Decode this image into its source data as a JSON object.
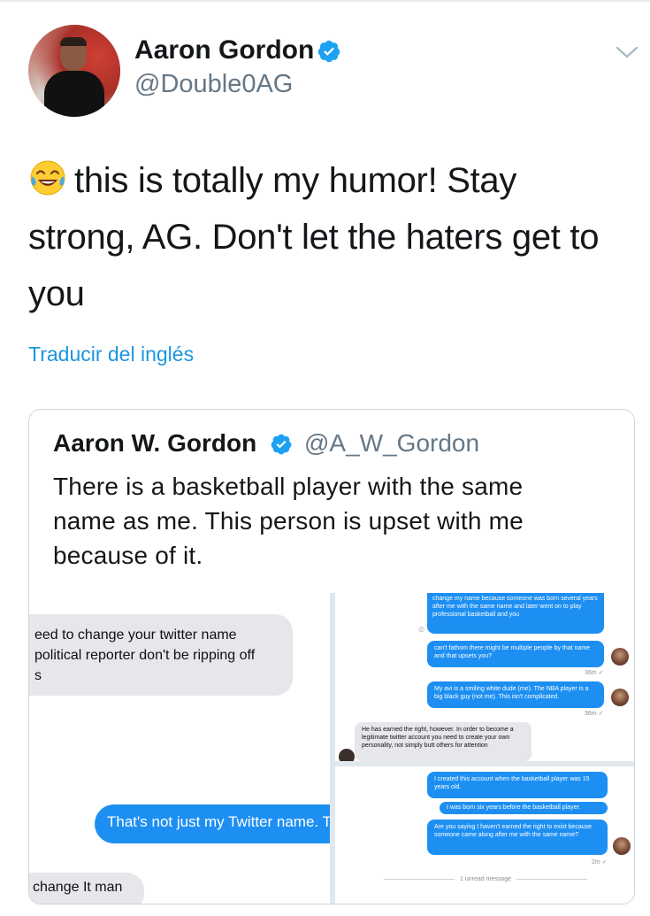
{
  "tweet": {
    "author_name": "Aaron Gordon",
    "author_handle": "@Double0AG",
    "emoji": "face-with-tears-of-joy",
    "line1": "this is totally my humor! Stay",
    "line2": "strong, AG. Don't let the haters get to",
    "line3": "you",
    "translate_link": "Traducir del inglés"
  },
  "quoted": {
    "author_name": "Aaron W. Gordon",
    "author_handle": "@A_W_Gordon",
    "line1": "There is a basketball player with the same",
    "line2": "name as me. This person is upset with me",
    "line3": "because of it."
  },
  "media": {
    "left": {
      "gray1_l1": "eed to change your twitter name",
      "gray1_l2": " political reporter don't be ripping off",
      "gray1_l3": "s",
      "blue1": "That's not just my Twitter name. T",
      "gray2": " change It man"
    },
    "right_top": {
      "blue1": "change my name because someone was born several years after me with the same name and later went on to play professional basketball and you",
      "blue2": "can't fathom there might be multiple people by that name and that upsets you?",
      "ts1": "36m ✓",
      "blue3": "My avi is a smiling white dude (me). The NBA player is a big black guy (not me). This isn't complicated.",
      "ts2": "36m ✓",
      "gray1": "He has earned the right, however. In order to become a legitimate twitter account you need to create your own personality, not simply butt others for attention"
    },
    "right_bottom": {
      "blue1": "I created this account when the basketball player was 15 years old.",
      "blue2": "I was born six years before the basketball player.",
      "blue3": "Are you saying I haven't earned the right to exist because someone came along after me with the same name?",
      "ts1": "2m ✓",
      "unread": "1 unread message"
    }
  },
  "colors": {
    "link": "#1b95e0",
    "verified": "#1da1f2",
    "imessage_blue": "#1d8ff2",
    "secondary_text": "#657786"
  }
}
